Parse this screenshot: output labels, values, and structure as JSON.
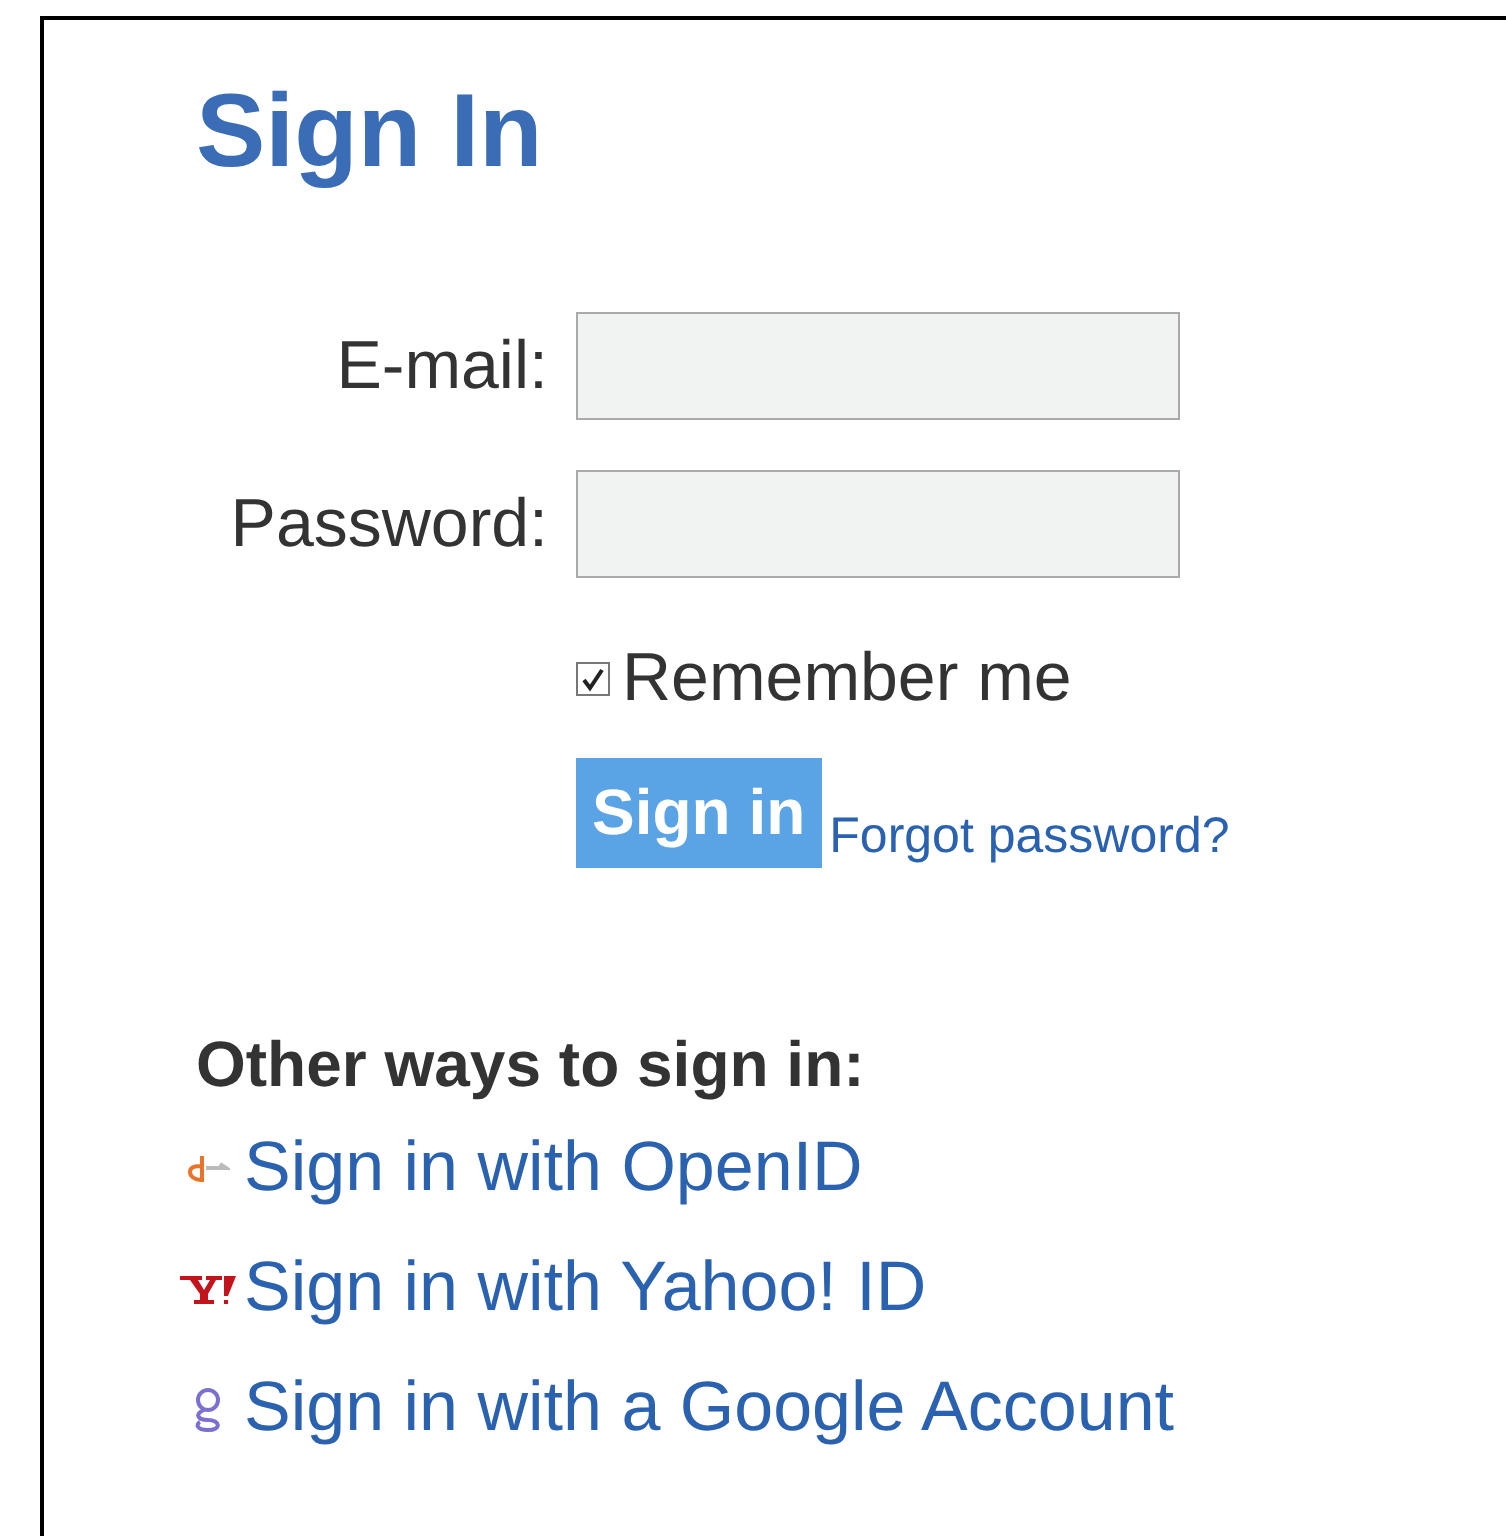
{
  "title": "Sign In",
  "fields": [
    {
      "label": "E-mail:"
    },
    {
      "label": "Password:"
    }
  ],
  "remember": {
    "label": "Remember me",
    "checked": true
  },
  "submit": "Sign in",
  "forgot": "Forgot password?",
  "other_heading": "Other ways to sign in:",
  "providers": [
    {
      "kind": "openid",
      "label": "Sign in with OpenID"
    },
    {
      "kind": "yahoo",
      "label": "Sign in with Yahoo! ID"
    },
    {
      "kind": "google",
      "label": "Sign in with a Google Account"
    }
  ]
}
